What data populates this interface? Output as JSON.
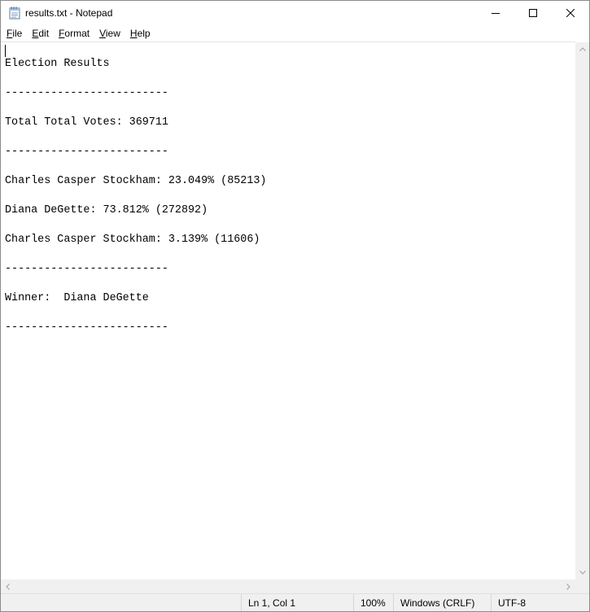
{
  "window": {
    "title": "results.txt - Notepad",
    "icons": {
      "app": "notepad-icon",
      "minimize": "minimize-icon",
      "maximize": "maximize-icon",
      "close": "close-icon"
    }
  },
  "menu": {
    "items": [
      {
        "underline": "F",
        "rest": "ile"
      },
      {
        "underline": "E",
        "rest": "dit"
      },
      {
        "underline": "F",
        "rest": "ormat"
      },
      {
        "underline": "V",
        "rest": "iew"
      },
      {
        "underline": "H",
        "rest": "elp"
      }
    ]
  },
  "document": {
    "lines": [
      "",
      "Election Results",
      "",
      "-------------------------",
      "",
      "Total Total Votes: 369711",
      "",
      "-------------------------",
      "",
      "Charles Casper Stockham: 23.049% (85213)",
      "",
      "Diana DeGette: 73.812% (272892)",
      "",
      "Charles Casper Stockham: 3.139% (11606)",
      "",
      "-------------------------",
      "",
      "Winner:  Diana DeGette",
      "",
      "-------------------------"
    ]
  },
  "status": {
    "position": "Ln 1, Col 1",
    "zoom": "100%",
    "line_endings": "Windows (CRLF)",
    "encoding": "UTF-8"
  }
}
